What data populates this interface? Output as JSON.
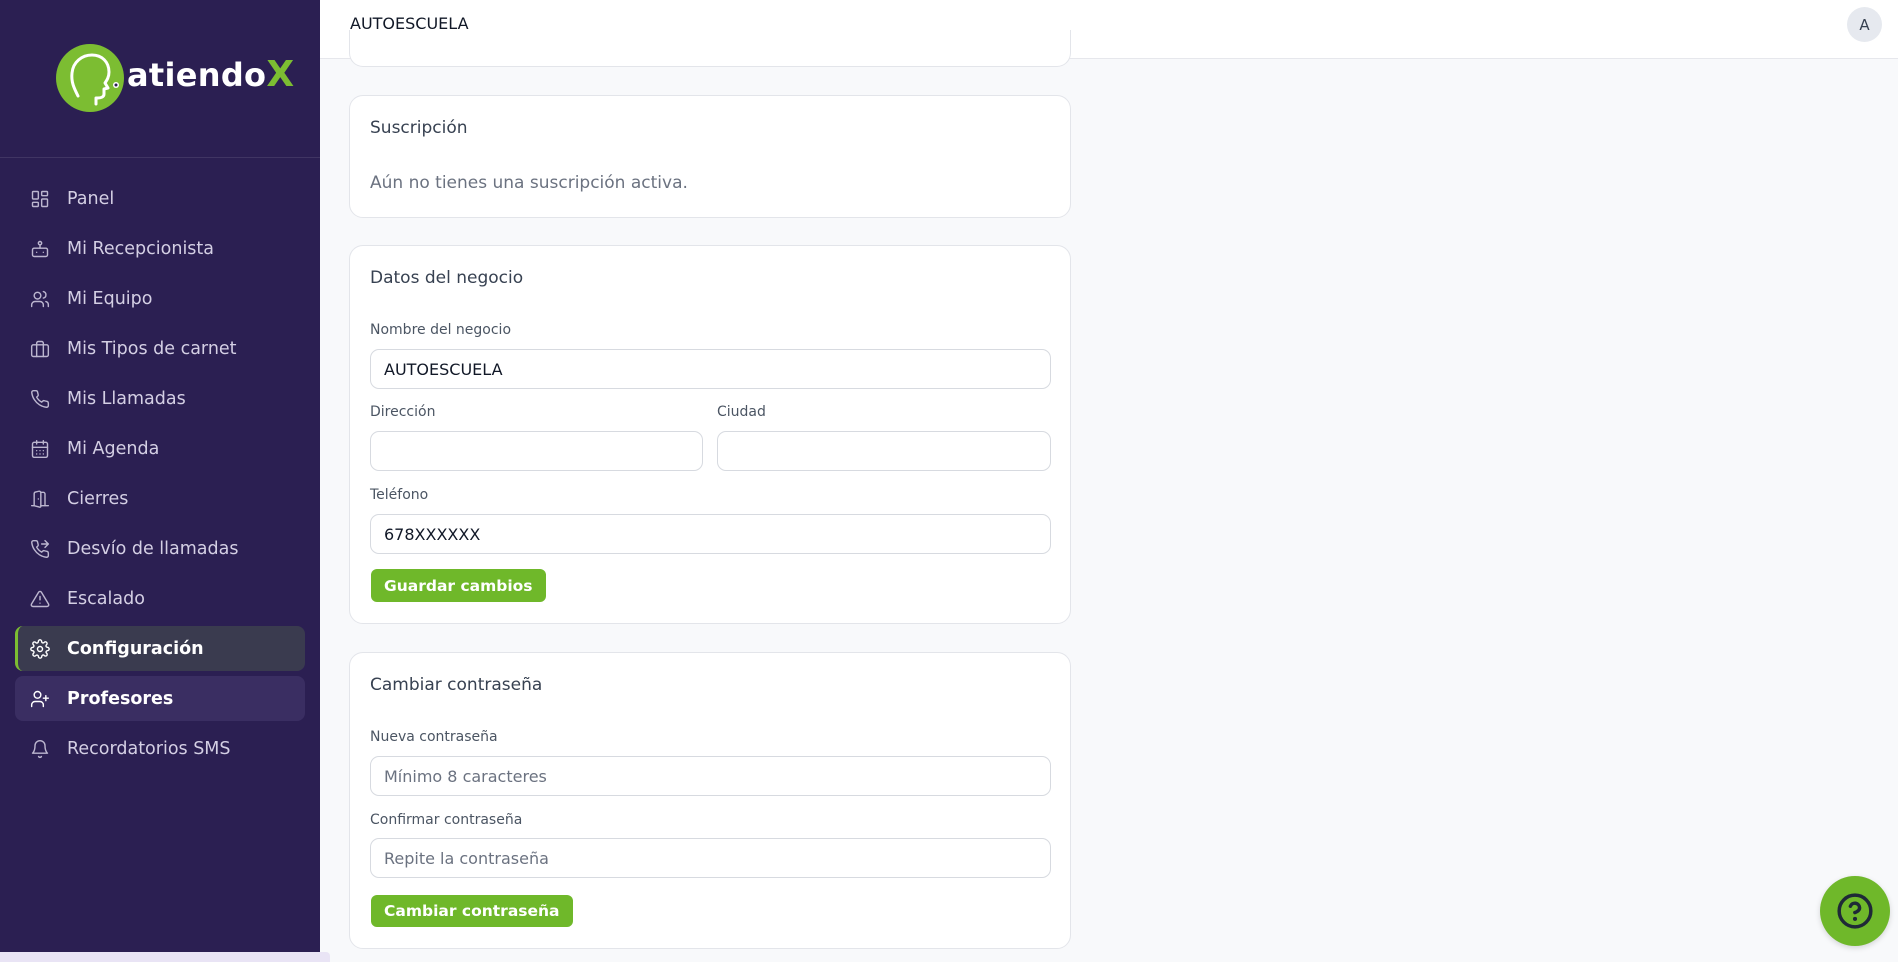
{
  "brand": {
    "name_part1": "atiendo",
    "name_part2": "X",
    "accent": "#7cbd32",
    "sidebar_bg": "#2b1f52"
  },
  "sidebar": {
    "items": [
      {
        "label": "Panel",
        "icon": "grid-icon"
      },
      {
        "label": "Mi Recepcionista",
        "icon": "bot-icon"
      },
      {
        "label": "Mi Equipo",
        "icon": "users-icon"
      },
      {
        "label": "Mis Tipos de carnet",
        "icon": "briefcase-icon"
      },
      {
        "label": "Mis Llamadas",
        "icon": "phone-icon"
      },
      {
        "label": "Mi Agenda",
        "icon": "calendar-icon"
      },
      {
        "label": "Cierres",
        "icon": "door-icon"
      },
      {
        "label": "Desvío de llamadas",
        "icon": "phone-forward-icon"
      },
      {
        "label": "Escalado",
        "icon": "alert-triangle-icon"
      },
      {
        "label": "Configuración",
        "icon": "gear-icon",
        "state": "active"
      },
      {
        "label": "Profesores",
        "icon": "user-plus-icon",
        "state": "hover"
      },
      {
        "label": "Recordatorios SMS",
        "icon": "bell-icon"
      }
    ]
  },
  "header": {
    "title": "AUTOESCUELA",
    "avatar_initial": "A"
  },
  "subscription": {
    "title": "Suscripción",
    "message": "Aún no tienes una suscripción activa."
  },
  "business": {
    "title": "Datos del negocio",
    "name_label": "Nombre del negocio",
    "name_value": "AUTOESCUELA",
    "address_label": "Dirección",
    "address_value": "",
    "city_label": "Ciudad",
    "city_value": "",
    "phone_label": "Teléfono",
    "phone_value": "678XXXXXX",
    "save_button": "Guardar cambios"
  },
  "password": {
    "title": "Cambiar contraseña",
    "new_label": "Nueva contraseña",
    "new_placeholder": "Mínimo 8 caracteres",
    "confirm_label": "Confirmar contraseña",
    "confirm_placeholder": "Repite la contraseña",
    "change_button": "Cambiar contraseña"
  },
  "help": {
    "icon": "help-circle-icon"
  }
}
